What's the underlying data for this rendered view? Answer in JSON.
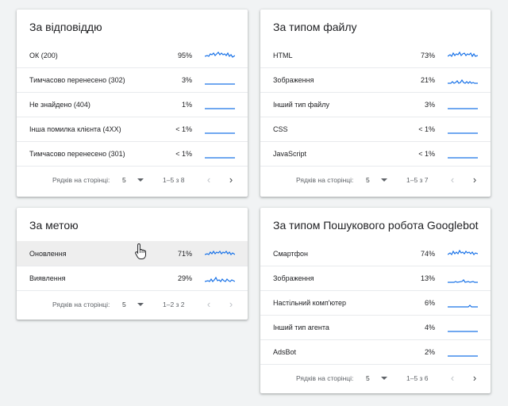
{
  "cards": {
    "response": {
      "title": "За відповіддю",
      "rows": [
        {
          "label": "ОК (200)",
          "pct": "95%"
        },
        {
          "label": "Тимчасово перенесено (302)",
          "pct": "3%"
        },
        {
          "label": "Не знайдено (404)",
          "pct": "1%"
        },
        {
          "label": "Інша помилка клієнта (4XX)",
          "pct": "< 1%"
        },
        {
          "label": "Тимчасово перенесено (301)",
          "pct": "< 1%"
        }
      ],
      "footer": {
        "rows_per_page_label": "Рядків на сторінці:",
        "rows_per_page_value": "5",
        "range": "1–5 з 8"
      }
    },
    "filetype": {
      "title": "За типом файлу",
      "rows": [
        {
          "label": "HTML",
          "pct": "73%"
        },
        {
          "label": "Зображення",
          "pct": "21%"
        },
        {
          "label": "Інший тип файлу",
          "pct": "3%"
        },
        {
          "label": "CSS",
          "pct": "< 1%"
        },
        {
          "label": "JavaScript",
          "pct": "< 1%"
        }
      ],
      "footer": {
        "rows_per_page_label": "Рядків на сторінці:",
        "rows_per_page_value": "5",
        "range": "1–5 з 7"
      }
    },
    "purpose": {
      "title": "За метою",
      "rows": [
        {
          "label": "Оновлення",
          "pct": "71%"
        },
        {
          "label": "Виявлення",
          "pct": "29%"
        }
      ],
      "footer": {
        "rows_per_page_label": "Рядків на сторінці:",
        "rows_per_page_value": "5",
        "range": "1–2 з 2"
      }
    },
    "googlebot": {
      "title": "За типом Пошукового робота Googlebot",
      "rows": [
        {
          "label": "Смартфон",
          "pct": "74%"
        },
        {
          "label": "Зображення",
          "pct": "13%"
        },
        {
          "label": "Настільний комп'ютер",
          "pct": "6%"
        },
        {
          "label": "Інший тип агента",
          "pct": "4%"
        },
        {
          "label": "AdsBot",
          "pct": "2%"
        }
      ],
      "footer": {
        "rows_per_page_label": "Рядків на сторінці:",
        "rows_per_page_value": "5",
        "range": "1–5 з 6"
      }
    }
  },
  "icons": {
    "prev": "chevron-left-icon",
    "next": "chevron-right-icon",
    "dropdown": "caret-down-icon",
    "cursor": "hand-pointer-icon"
  },
  "colors": {
    "accent": "#1a73e8",
    "background": "#f1f3f4",
    "hover_row": "#eeeeee"
  }
}
